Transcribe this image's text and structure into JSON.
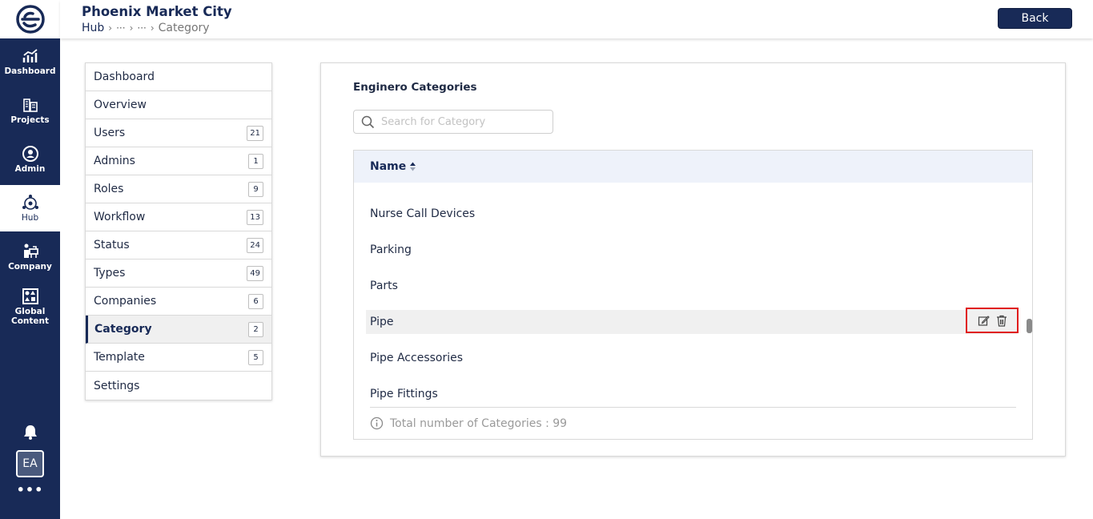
{
  "rail": {
    "items": [
      {
        "label": "Dashboard",
        "icon": "chart-icon"
      },
      {
        "label": "Projects",
        "icon": "buildings-icon"
      },
      {
        "label": "Admin",
        "icon": "admin-icon"
      },
      {
        "label": "Hub",
        "icon": "hub-icon"
      },
      {
        "label": "Company",
        "icon": "company-icon"
      },
      {
        "label": "Global\nContent",
        "icon": "global-content-icon"
      }
    ],
    "active": "Hub",
    "avatar": "EA",
    "more": "•••",
    "brand_color": "#182a57"
  },
  "header": {
    "title": "Phoenix Market City",
    "breadcrumb": {
      "root": "Hub",
      "ellipsis1": "···",
      "ellipsis2": "···",
      "current": "Category"
    },
    "back_label": "Back"
  },
  "menu": {
    "items": [
      {
        "label": "Dashboard",
        "count": ""
      },
      {
        "label": "Overview",
        "count": ""
      },
      {
        "label": "Users",
        "count": "21"
      },
      {
        "label": "Admins",
        "count": "1"
      },
      {
        "label": "Roles",
        "count": "9"
      },
      {
        "label": "Workflow",
        "count": "13"
      },
      {
        "label": "Status",
        "count": "24"
      },
      {
        "label": "Types",
        "count": "49"
      },
      {
        "label": "Companies",
        "count": "6"
      },
      {
        "label": "Category",
        "count": "2"
      },
      {
        "label": "Template",
        "count": "5"
      },
      {
        "label": "Settings",
        "count": ""
      }
    ],
    "active": "Category"
  },
  "main": {
    "title": "Enginero Categories",
    "search_placeholder": "Search for Category",
    "column_name": "Name",
    "rows": [
      "Nurse Call Devices",
      "Parking",
      "Parts",
      "Pipe",
      "Pipe Accessories",
      "Pipe Fittings"
    ],
    "hovered_row": "Pipe",
    "footer_text": "Total number of Categories : 99"
  }
}
